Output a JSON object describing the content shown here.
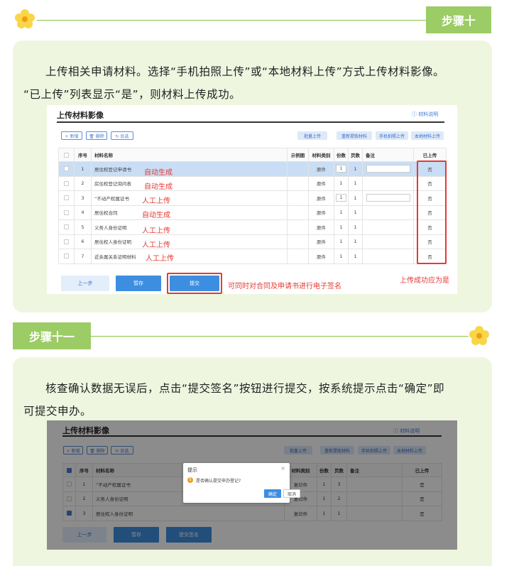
{
  "step10": {
    "label": "步骤十",
    "para_line1": "上传相关申请材料。选择“手机拍照上传”或“本地材料上传”方式上传材料影像。",
    "para_line2": "“已上传”列表显示“是”，则材料上传成功。",
    "shot": {
      "title": "上传材料影像",
      "help": "ⓘ 材料说明",
      "left_buttons": [
        "+ 新增",
        "🗑 删除",
        "↻ 反选"
      ],
      "right_buttons": [
        "批量上传",
        "重新提取材料",
        "手机拍照上传",
        "本地材料上传"
      ],
      "columns": [
        "",
        "序号",
        "材料名称",
        "示例图",
        "材料类别",
        "份数",
        "页数",
        "备注",
        "已上传"
      ],
      "rows": [
        {
          "no": "1",
          "name": "居住权登记申请书",
          "category": "原件",
          "copies": "1",
          "pages": "1",
          "uploaded": "否",
          "tag": "自动生成"
        },
        {
          "no": "2",
          "name": "房住权登记询问表",
          "category": "原件",
          "copies": "1",
          "pages": "1",
          "uploaded": "否",
          "tag": "自动生成"
        },
        {
          "no": "3",
          "name": "“不动产权属证书",
          "category": "原件",
          "copies": "1",
          "pages": "1",
          "uploaded": "否",
          "tag": "人工上传"
        },
        {
          "no": "4",
          "name": "居住权合同",
          "category": "原件",
          "copies": "1",
          "pages": "1",
          "uploaded": "否",
          "tag": "自动生成"
        },
        {
          "no": "5",
          "name": "义务人身份证明",
          "category": "原件",
          "copies": "1",
          "pages": "1",
          "uploaded": "否",
          "tag": "人工上传"
        },
        {
          "no": "6",
          "name": "居住权人身份证明",
          "category": "原件",
          "copies": "1",
          "pages": "1",
          "uploaded": "否",
          "tag": "人工上传"
        },
        {
          "no": "7",
          "name": "近亲属关系证明材料",
          "category": "原件",
          "copies": "1",
          "pages": "1",
          "uploaded": "否",
          "tag": "人工上传"
        }
      ],
      "prev_btn": "上一步",
      "save_btn": "暂存",
      "submit_btn": "提交",
      "sign_note": "可同时对合同及申请书进行电子签名",
      "upload_note": "上传成功应为是"
    }
  },
  "step11": {
    "label": "步骤十一",
    "para_line1": "核查确认数据无误后，点击“提交签名”按钮进行提交，按系统提示点击“确定”即",
    "para_line2": "可提交申办。",
    "shot": {
      "title": "上传材料影像",
      "help": "ⓘ 材料说明",
      "left_buttons": [
        "+ 新增",
        "🗑 删除",
        "↻ 反选"
      ],
      "right_buttons": [
        "批量上传",
        "重新提取材料",
        "手机拍照上传",
        "本地材料上传"
      ],
      "columns": [
        "",
        "序号",
        "材料名称",
        "示例图",
        "材料类别",
        "份数",
        "页数",
        "备注",
        "已上传"
      ],
      "rows": [
        {
          "no": "1",
          "name": "“不动产权属证书",
          "category": "复印件",
          "copies": "1",
          "pages": "3",
          "uploaded": "是"
        },
        {
          "no": "2",
          "name": "义务人身份证明",
          "category": "复印件",
          "copies": "1",
          "pages": "2",
          "uploaded": "是"
        },
        {
          "no": "3",
          "name": "居住权人身份证明",
          "category": "复印件",
          "copies": "1",
          "pages": "1",
          "uploaded": "是"
        }
      ],
      "prev_btn": "上一步",
      "save_btn": "暂存",
      "submit_btn": "提交签名",
      "dialog": {
        "title": "提示",
        "message": "是否确认提交申办登记?",
        "ok": "确定",
        "cancel": "取消"
      }
    }
  },
  "colors": {
    "accent_green": "#9ccc65",
    "panel_bg": "#eef6e0",
    "note_red": "#e53935",
    "button_blue": "#3d8ee0"
  }
}
